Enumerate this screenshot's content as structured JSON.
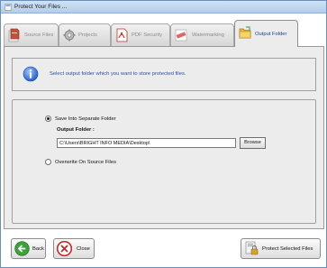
{
  "window": {
    "title": "Protect Your Files ..."
  },
  "tabs": [
    {
      "label": "Source Files",
      "icon": "source-files-icon",
      "active": false
    },
    {
      "label": "Projects",
      "icon": "projects-gear-icon",
      "active": false
    },
    {
      "label": "PDF Security",
      "icon": "pdf-icon",
      "active": false
    },
    {
      "label": "Watermarking",
      "icon": "watermark-stamp-icon",
      "active": false
    },
    {
      "label": "Output Folder",
      "icon": "folder-icon",
      "active": true
    }
  ],
  "info": {
    "icon": "info-icon",
    "text": "Select output folder which you want to store protected files."
  },
  "options": {
    "save_separate": {
      "label": "Save Into Separate Folder",
      "selected": true
    },
    "output_folder_label": "Output Folder :",
    "output_folder_value": "C:\\Users\\BRIGHT INFO MEDIA\\Desktop\\",
    "browse_label": "Browse",
    "overwrite": {
      "label": "Overwrite On Source Files",
      "selected": false
    }
  },
  "footer": {
    "back_label": "Back",
    "close_label": "Close",
    "protect_label": "Protect Selected Files"
  },
  "colors": {
    "accent_text": "#2e4f9e",
    "active_tab_text": "#1e3f8a",
    "panel_bg": "#ececec"
  }
}
